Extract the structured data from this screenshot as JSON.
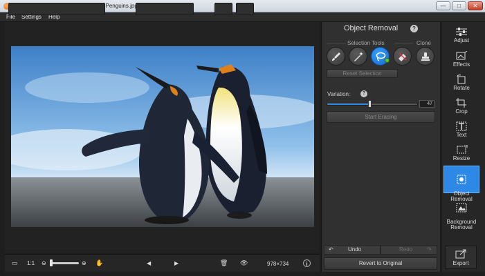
{
  "window": {
    "title": "Movavi Photo Editor – Trial version – Penguins.jpg",
    "minimize": "—",
    "maximize": "□",
    "close": "✕"
  },
  "menu": {
    "items": [
      "File",
      "Settings",
      "Help"
    ]
  },
  "panel": {
    "title": "Object Removal",
    "help": "?",
    "selection_tools_label": "Selection Tools",
    "clone_label": "Clone",
    "tools": [
      "brush-icon",
      "magic-wand-icon",
      "lasso-icon",
      "eraser-icon",
      "stamp-icon"
    ],
    "active_tool": "lasso-icon",
    "reset_selection": "Reset Selection",
    "variation_label": "Variation:",
    "variation_value": "47",
    "variation_max": 100,
    "start_erasing": "Start Erasing",
    "undo": "Undo",
    "redo": "Redo",
    "revert": "Revert to Original"
  },
  "strip": {
    "items": [
      {
        "label": "Adjust",
        "icon": "sliders-icon"
      },
      {
        "label": "Effects",
        "icon": "effects-icon"
      },
      {
        "label": "Rotate",
        "icon": "rotate-icon"
      },
      {
        "label": "Crop",
        "icon": "crop-icon"
      },
      {
        "label": "Text",
        "icon": "text-icon"
      },
      {
        "label": "Resize",
        "icon": "resize-icon"
      },
      {
        "label": "Object\nRemoval",
        "icon": "object-removal-icon",
        "active": true
      },
      {
        "label": "Background\nRemoval",
        "icon": "background-removal-icon"
      }
    ],
    "export": "Export"
  },
  "toolbar": {
    "zoom_1to1": "1:1",
    "zoom_level": 0.1,
    "image_size": "978×734",
    "info": "i"
  },
  "colors": {
    "accent": "#2e89e6",
    "panel_bg": "#303030",
    "canvas_bg": "#222222"
  }
}
